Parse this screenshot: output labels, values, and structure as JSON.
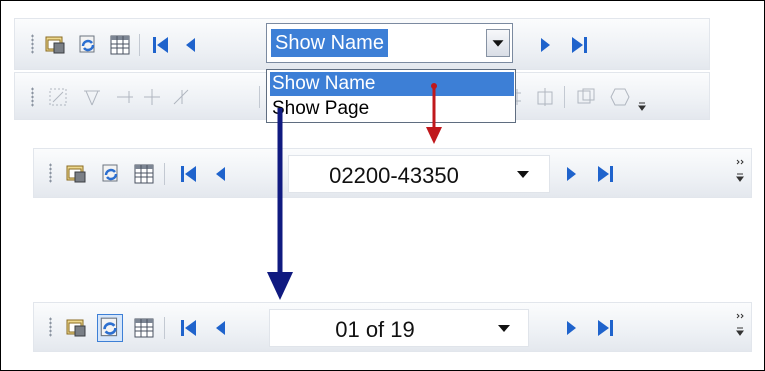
{
  "top_toolbar": {
    "dropdown": {
      "selected_value": "Show Name",
      "options": [
        "Show Name",
        "Show Page"
      ]
    }
  },
  "middle_toolbar": {
    "page_value": "02200-43350"
  },
  "bottom_toolbar": {
    "page_value": "01 of 19"
  },
  "icons": [
    "properties-icon",
    "refresh-icon",
    "table-icon",
    "first-page-icon",
    "previous-page-icon",
    "next-page-icon",
    "last-page-icon"
  ],
  "colors": {
    "selection": "#3d7fd6",
    "red_arrow": "#c0181c",
    "blue_arrow": "#101a80",
    "nav_blue": "#1f63cc"
  }
}
